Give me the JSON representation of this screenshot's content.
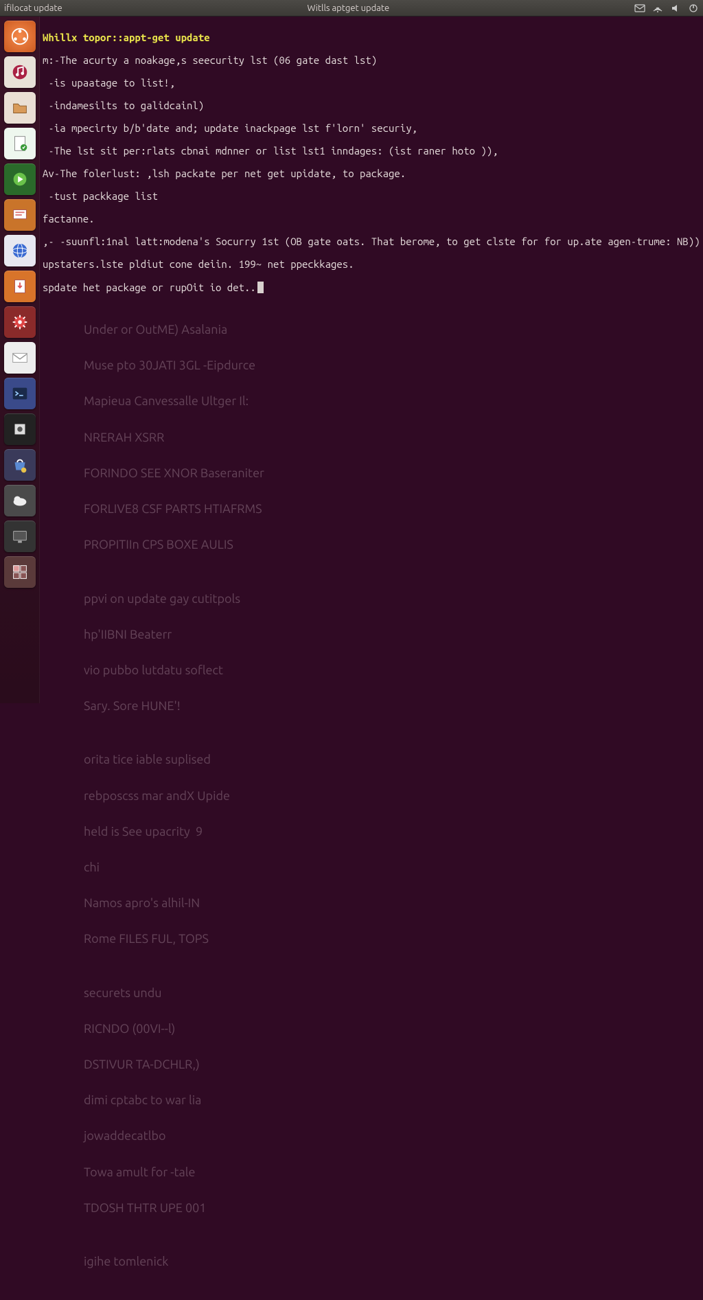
{
  "topbar": {
    "left_label": "ifilocat update",
    "title": "Witlls aptget update",
    "indicators": [
      "mail-icon",
      "network-icon",
      "sound-icon",
      "power-icon"
    ]
  },
  "launcher": {
    "items": [
      {
        "name": "dash-icon",
        "label": "Dash"
      },
      {
        "name": "music-icon",
        "label": "Music"
      },
      {
        "name": "files-icon",
        "label": "Files"
      },
      {
        "name": "document-icon",
        "label": "Document"
      },
      {
        "name": "media-icon",
        "label": "Media"
      },
      {
        "name": "slides-icon",
        "label": "Slides"
      },
      {
        "name": "browser-icon",
        "label": "Browser"
      },
      {
        "name": "update-icon",
        "label": "Software Updater"
      },
      {
        "name": "settings-icon",
        "label": "Settings"
      },
      {
        "name": "mail-icon",
        "label": "Mail"
      },
      {
        "name": "terminal-icon",
        "label": "Terminal"
      },
      {
        "name": "app-icon",
        "label": "App"
      },
      {
        "name": "store-icon",
        "label": "Software Center"
      },
      {
        "name": "weather-icon",
        "label": "Weather"
      },
      {
        "name": "monitor-icon",
        "label": "Monitor"
      },
      {
        "name": "workspace-icon",
        "label": "Workspace"
      }
    ]
  },
  "terminal": {
    "prompt": "Whillx topor::appt-get update",
    "lines": [
      "m:-The acurty a noakage,s seecurity lst (06 gate dast lst)",
      " -is upaatage to list!,",
      " -indamesilts to galidcainl)",
      " -ia mpecirty b/b'date and; update inackpage lst f'lorn' securiy,",
      " -The lst sit per:rlats cbnai mdnner or list lst1 inndages: (ist raner hoto )),",
      "Av-The folerlust: ,lsh packate per net get upidate, to package.",
      " -tust packkage list",
      "factanne.",
      ",- -suunfl:1nal latt:modena's Socurry 1st (OB gate oats. That berome, to get clste for for up.ate agen-trume: NB))",
      "upstaters.lste pldiut cone deiin. 199~ net ppeckkages.",
      "spdate het package or rupOit io det.."
    ],
    "background": [
      "Under or OutME) Asalania",
      "Muse pto 30JATI 3GL -Eipdurce",
      "Mapieua Canvessalle Ultger Il:",
      "NRERAH XSRR",
      "FORINDO SEE XNOR Baseraniter",
      "FORLIVE8 CSF PARTS HTIAFRMS",
      "PROPITIIn CPS BOXE AULIS",
      "",
      "ppvi on update gay cutitpols",
      "hp'IIBNI Beaterr",
      "vio pubbo lutdatu soflect",
      "Sary. Sore HUNE'!",
      "",
      "orita tice iable suplised",
      "rebposcss mar andX Upide",
      "held is See upacrity  9",
      "chi",
      "Namos apro's alhil-IN",
      "Rome FILES FUL, TOPS",
      "",
      "securets undu",
      "RICNDO (00VI--l)",
      "DSTIVUR TA-DCHLR,)",
      "dimi cptabc to war lia",
      "jowaddecatlbo",
      "Towa amult for -tale",
      "TDOSH THTR UPE 001",
      "",
      "igihe tomlenick"
    ]
  },
  "colors": {
    "bg": "#300a24",
    "fg": "#e6dddc",
    "prompt": "#e8e24a",
    "panel": "#3c3a36"
  }
}
